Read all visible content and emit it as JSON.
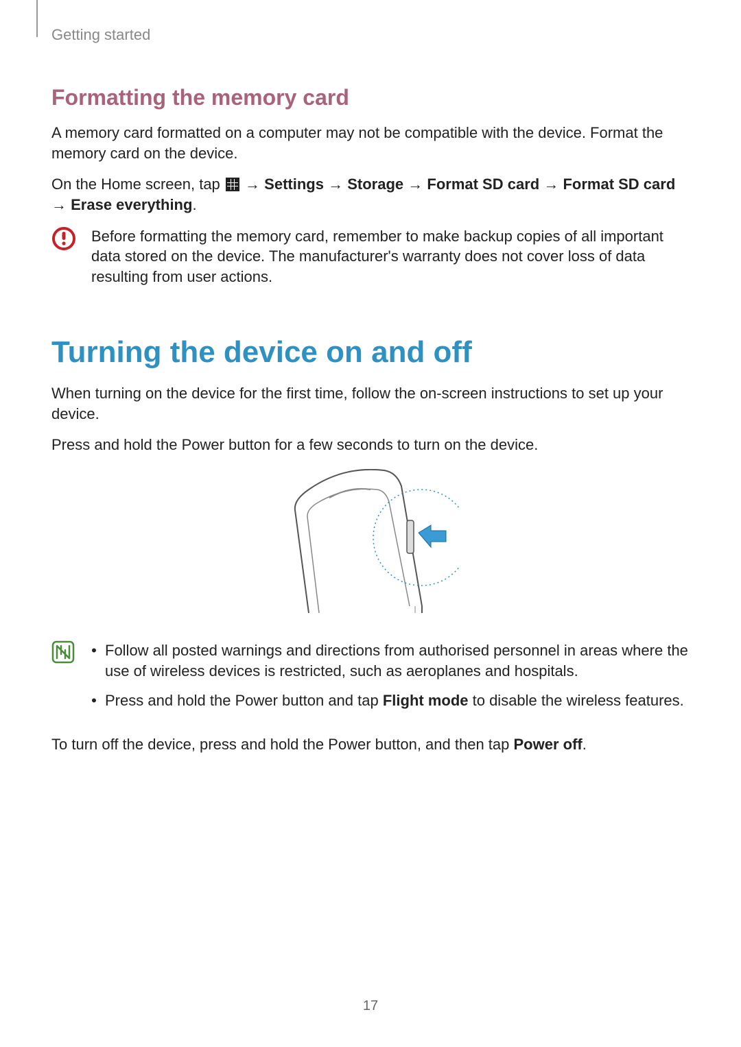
{
  "header": {
    "section": "Getting started"
  },
  "formatting": {
    "heading": "Formatting the memory card",
    "p1": "A memory card formatted on a computer may not be compatible with the device. Format the memory card on the device.",
    "instr_prefix": "On the Home screen, tap ",
    "arrow": " → ",
    "settings": "Settings",
    "storage": "Storage",
    "format1": "Format SD card",
    "format2": "Format SD card",
    "erase": "Erase everything",
    "period": ".",
    "caution": "Before formatting the memory card, remember to make backup copies of all important data stored on the device. The manufacturer's warranty does not cover loss of data resulting from user actions."
  },
  "power": {
    "heading": "Turning the device on and off",
    "p1": "When turning on the device for the first time, follow the on-screen instructions to set up your device.",
    "p2": "Press and hold the Power button for a few seconds to turn on the device.",
    "tip1": "Follow all posted warnings and directions from authorised personnel in areas where the use of wireless devices is restricted, such as aeroplanes and hospitals.",
    "tip2_a": "Press and hold the Power button and tap ",
    "tip2_b": "Flight mode",
    "tip2_c": " to disable the wireless features.",
    "off_a": "To turn off the device, press and hold the Power button, and then tap ",
    "off_b": "Power off",
    "off_c": "."
  },
  "page_number": "17"
}
